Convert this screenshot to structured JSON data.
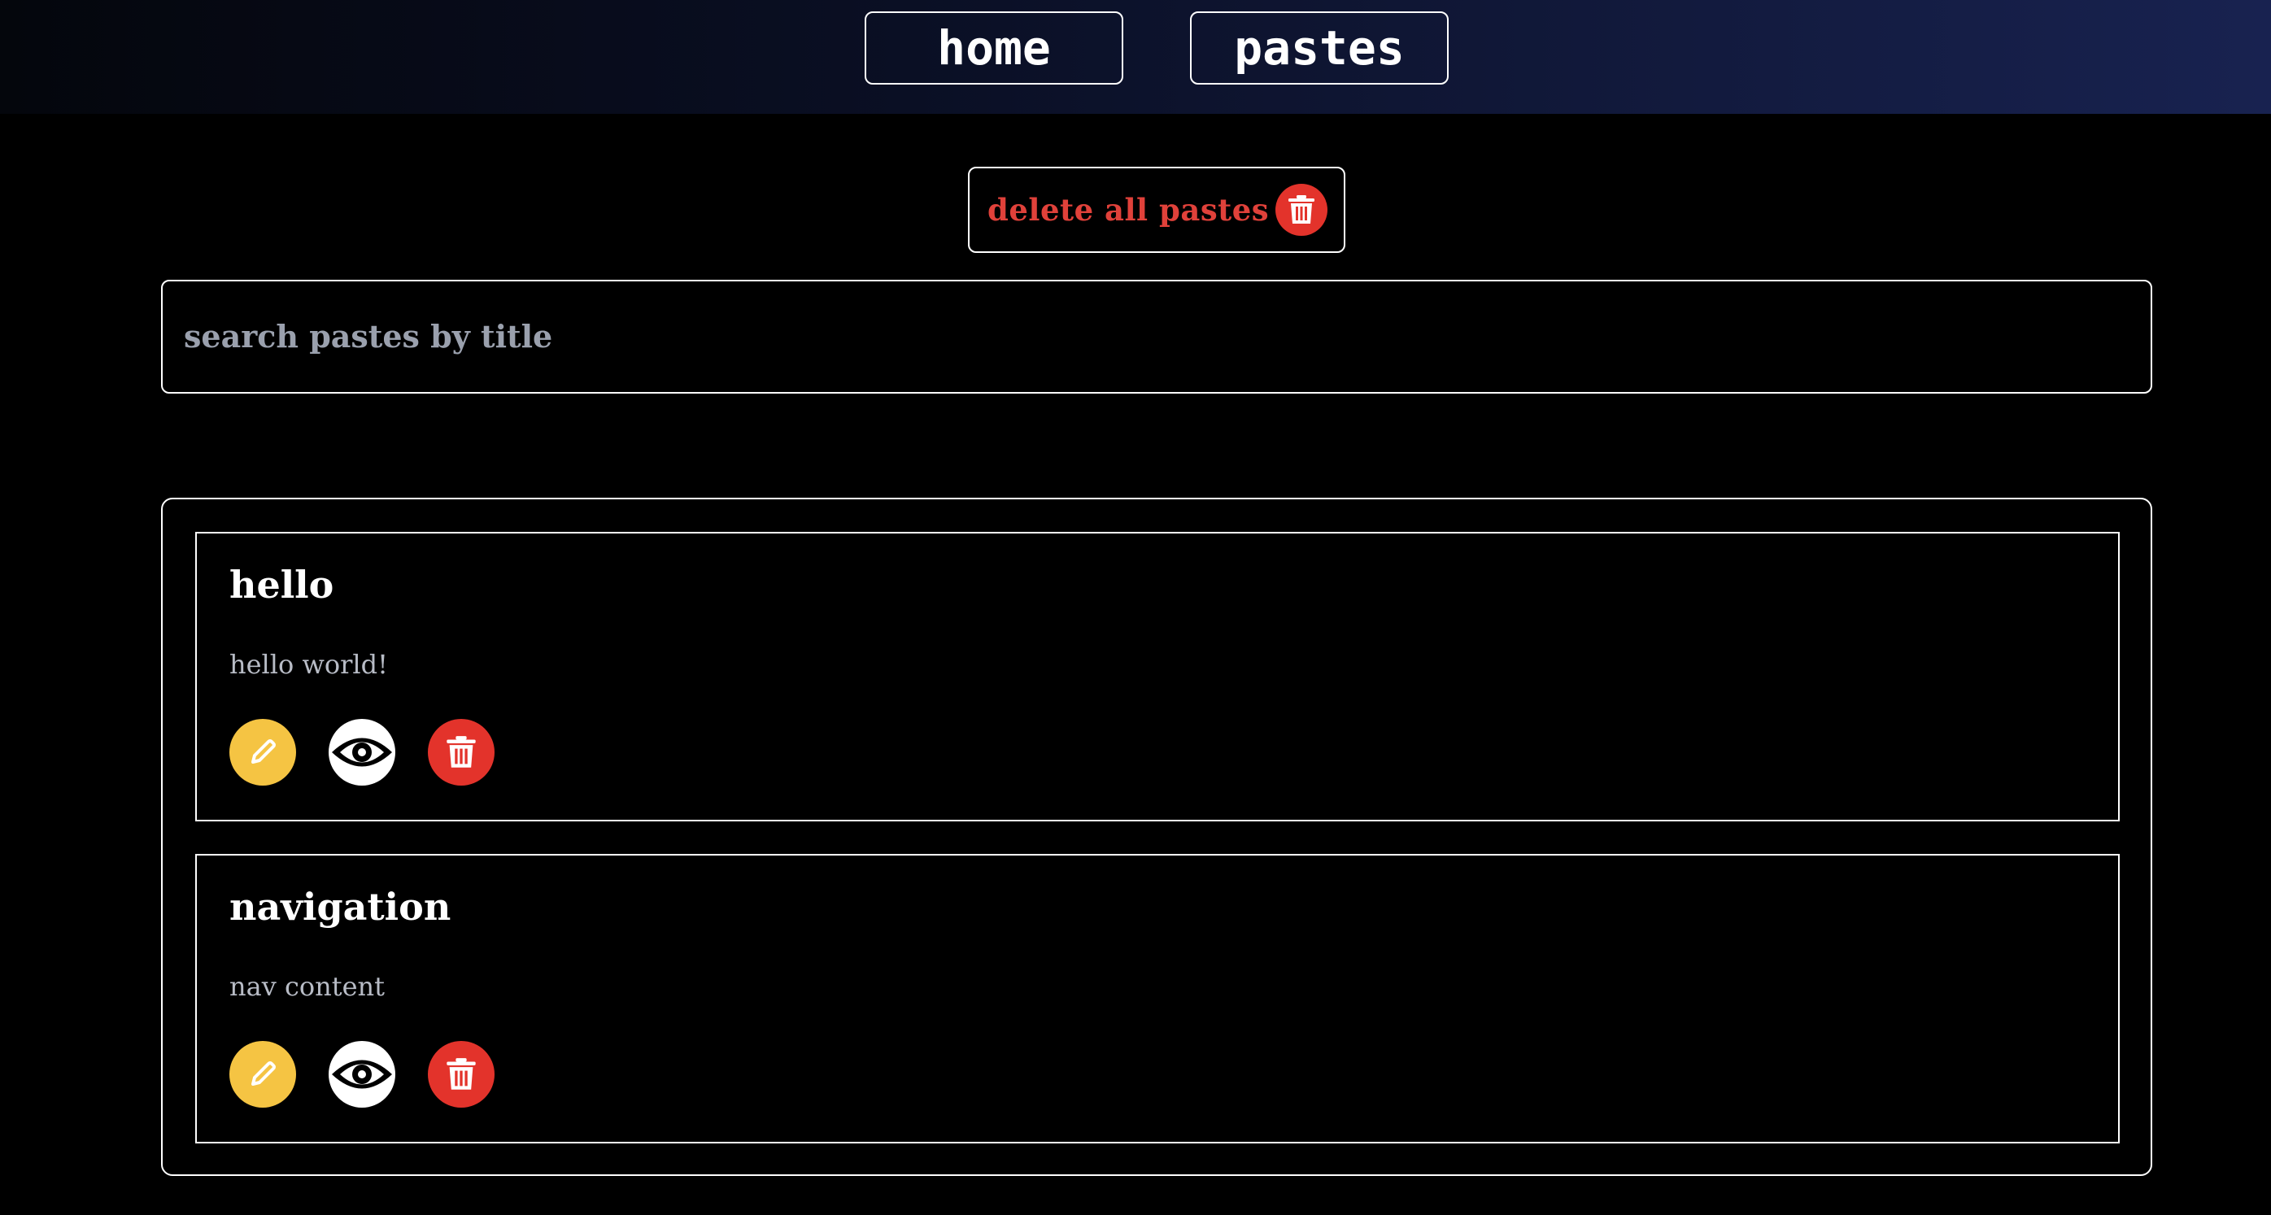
{
  "nav": {
    "home_label": "home",
    "pastes_label": "pastes"
  },
  "delete_all": {
    "label": "delete all pastes",
    "icon": "trash-icon"
  },
  "search": {
    "placeholder": "search pastes by title",
    "value": ""
  },
  "pastes": [
    {
      "title": "hello",
      "content": "hello world!",
      "actions": [
        "pencil-icon",
        "eye-icon",
        "trash-icon"
      ]
    },
    {
      "title": "navigation",
      "content": "nav content",
      "actions": [
        "pencil-icon",
        "eye-icon",
        "trash-icon"
      ]
    }
  ],
  "colors": {
    "danger": "#e3332b",
    "edit": "#f5c443",
    "view": "#ffffff",
    "background": "#000000"
  }
}
